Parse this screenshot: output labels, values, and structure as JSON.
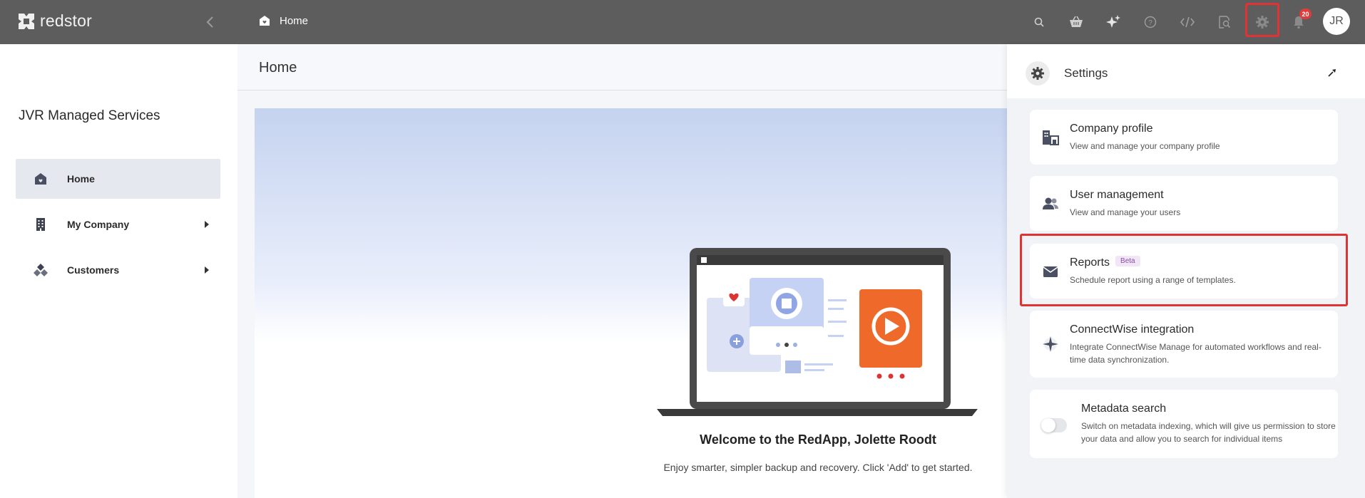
{
  "app": {
    "logo_text": "redstor"
  },
  "header": {
    "breadcrumb": "Home",
    "notification_count": "20",
    "avatar_initials": "JR",
    "icons": [
      "search-icon",
      "basket-icon",
      "sparkle-icon",
      "help-icon",
      "code-icon",
      "inspect-icon",
      "gear-icon",
      "bell-icon"
    ]
  },
  "sidebar": {
    "org_name": "JVR Managed Services",
    "items": [
      {
        "label": "Home",
        "icon": "home-icon",
        "active": true
      },
      {
        "label": "My Company",
        "icon": "building-icon",
        "expandable": true
      },
      {
        "label": "Customers",
        "icon": "customers-icon",
        "expandable": true
      }
    ]
  },
  "main": {
    "page_title": "Home",
    "welcome_title": "Welcome to the RedApp, Jolette Roodt",
    "welcome_sub": "Enjoy smarter, simpler backup and recovery. Click 'Add' to get started."
  },
  "settings": {
    "title": "Settings",
    "cards": [
      {
        "title": "Company profile",
        "desc": "View and manage your company profile",
        "icon": "company-icon"
      },
      {
        "title": "User management",
        "desc": "View and manage your users",
        "icon": "users-icon"
      },
      {
        "title": "Reports",
        "badge": "Beta",
        "desc": "Schedule report using a range of templates.",
        "icon": "mail-icon"
      },
      {
        "title": "ConnectWise integration",
        "desc": "Integrate ConnectWise Manage for automated workflows and real-time data synchronization.",
        "icon": "connectwise-icon"
      },
      {
        "title": "Metadata search",
        "desc": "Switch on metadata indexing, which will give us permission to store your data and allow you to search for individual items",
        "toggle_on": false
      }
    ]
  },
  "colors": {
    "topbar": "#5d5d5d",
    "highlight": "#e03333",
    "active_nav": "#e6e8ef",
    "badge": "#e23b3b"
  }
}
